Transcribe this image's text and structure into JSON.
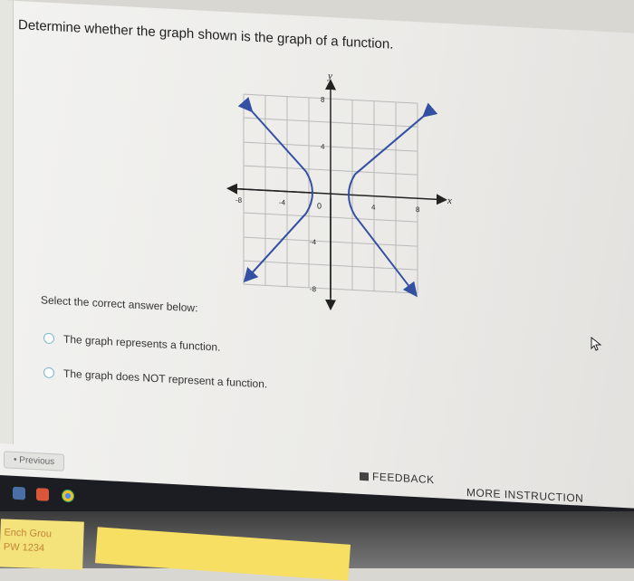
{
  "question": {
    "text": "Determine whether the graph shown is the graph of a function."
  },
  "graph": {
    "y_axis_label": "y",
    "x_axis_label": "x",
    "x_ticks": [
      "-8",
      "-4",
      "4",
      "8"
    ],
    "y_ticks": [
      "8",
      "4",
      "-4",
      "-8"
    ],
    "origin_label": "0"
  },
  "answer": {
    "prompt": "Select the correct answer below:",
    "options": [
      "The graph represents a function.",
      "The graph does NOT represent a function."
    ]
  },
  "footer": {
    "previous_label": "• Previous",
    "feedback_label": "FEEDBACK",
    "more_instruction_label": "MORE INSTRUCTION"
  },
  "note": {
    "line1": "Ench Grou",
    "line2": "PW 1234"
  },
  "colors": {
    "curve": "#3350a3",
    "radio": "#7cb8c9"
  }
}
